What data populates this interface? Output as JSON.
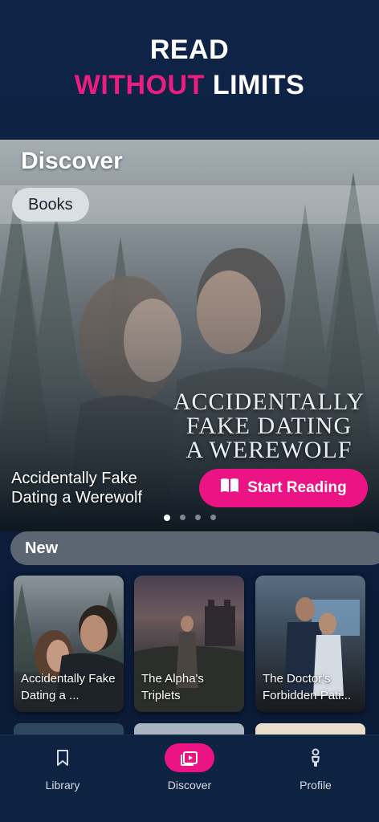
{
  "header": {
    "line1": "READ",
    "line2_accent": "WITHOUT",
    "line2_rest": " LIMITS",
    "accent_color": "#ec1d7f"
  },
  "feature": {
    "section_title": "Discover",
    "filter_chip": "Books",
    "cover_title_lines": [
      "ACCIDENTALLY",
      "FAKE DATING",
      "A WEREWOLF"
    ],
    "book_title": "Accidentally Fake Dating a Werewolf",
    "cta_label": "Start Reading",
    "cta_icon": "open-book-icon",
    "carousel": {
      "count": 4,
      "active": 1
    }
  },
  "new_section": {
    "title": "New",
    "books": [
      {
        "title": "Accidentally Fake Dating a ..."
      },
      {
        "title": "The Alpha's Triplets"
      },
      {
        "title": "The Doctor's Forbidden Pati..."
      }
    ]
  },
  "bottom_nav": {
    "items": [
      {
        "label": "Library",
        "icon": "bookmark-icon"
      },
      {
        "label": "Discover",
        "icon": "video-library-icon",
        "active": true
      },
      {
        "label": "Profile",
        "icon": "person-icon"
      }
    ]
  },
  "colors": {
    "brand_pink": "#ec1384",
    "background": "#0c1d3b"
  }
}
